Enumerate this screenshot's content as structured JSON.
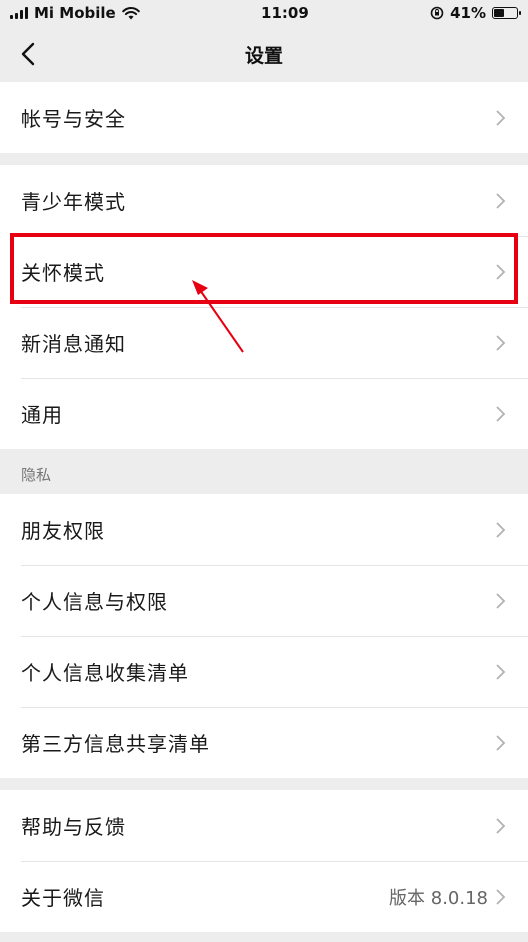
{
  "status_bar": {
    "carrier": "Mi Mobile",
    "time": "11:09",
    "battery": "41%"
  },
  "nav": {
    "title": "设置"
  },
  "groups": {
    "account": [
      {
        "label": "帐号与安全"
      }
    ],
    "modes": [
      {
        "label": "青少年模式"
      },
      {
        "label": "关怀模式"
      },
      {
        "label": "新消息通知"
      },
      {
        "label": "通用"
      }
    ],
    "privacy_header": "隐私",
    "privacy": [
      {
        "label": "朋友权限"
      },
      {
        "label": "个人信息与权限"
      },
      {
        "label": "个人信息收集清单"
      },
      {
        "label": "第三方信息共享清单"
      }
    ],
    "about": [
      {
        "label": "帮助与反馈"
      },
      {
        "label": "关于微信",
        "value": "版本 8.0.18"
      }
    ]
  },
  "colors": {
    "highlight": "#e60012",
    "background": "#ededed",
    "card": "#ffffff"
  }
}
